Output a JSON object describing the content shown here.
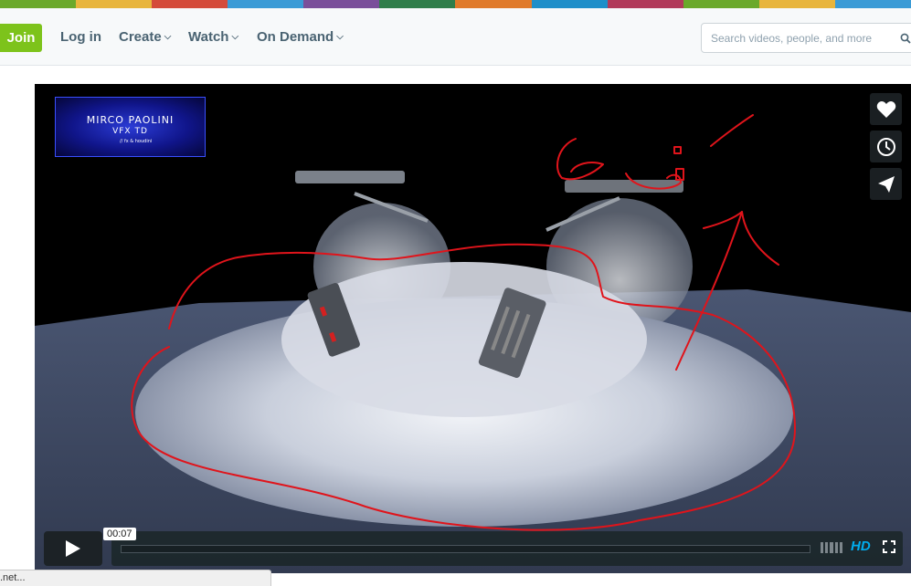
{
  "header": {
    "join_label": "Join",
    "login_label": "Log in",
    "create_label": "Create",
    "watch_label": "Watch",
    "ondemand_label": "On Demand",
    "search_placeholder": "Search videos, people, and more"
  },
  "video": {
    "logo_title": "MIRCO PAOLINI",
    "logo_subtitle": "VFX TD",
    "logo_tag": "// fx & houdini",
    "current_time": "00:07",
    "quality_label": "HD",
    "progress": 0.0
  },
  "side_buttons": [
    "heart-icon",
    "clock-icon",
    "send-icon"
  ],
  "statusbar": {
    "text": ".net..."
  },
  "colors": {
    "brand_green": "#7dc31b",
    "nav_text": "#4a6372",
    "hd_blue": "#00adef",
    "annotation_red": "#e0141b"
  }
}
